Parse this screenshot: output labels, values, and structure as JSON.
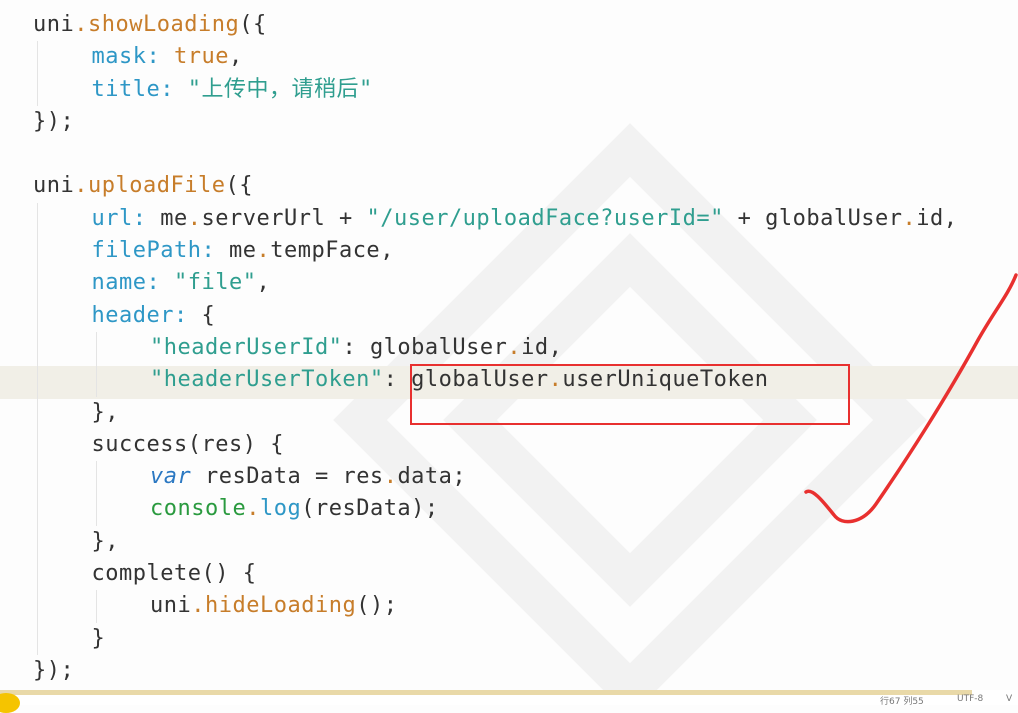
{
  "editor": {
    "highlight_color": "#f1efe7",
    "lines": [
      {
        "indent": 0,
        "tokens": [
          {
            "text": "uni",
            "cls": "p"
          },
          {
            "text": ".",
            "cls": "f"
          },
          {
            "text": "showLoading",
            "cls": "f"
          },
          {
            "text": "({",
            "cls": "p"
          }
        ]
      },
      {
        "indent": 1,
        "tokens": [
          {
            "text": "mask",
            "cls": "k"
          },
          {
            "text": ": ",
            "cls": "k"
          },
          {
            "text": "true",
            "cls": "b"
          },
          {
            "text": ",",
            "cls": "p"
          }
        ]
      },
      {
        "indent": 1,
        "tokens": [
          {
            "text": "title",
            "cls": "k"
          },
          {
            "text": ": ",
            "cls": "k"
          },
          {
            "text": "\"上传中，请稍后\"",
            "cls": "s"
          }
        ]
      },
      {
        "indent": 0,
        "tokens": [
          {
            "text": "});",
            "cls": "p"
          }
        ]
      },
      {
        "indent": 0,
        "tokens": []
      },
      {
        "indent": 0,
        "tokens": [
          {
            "text": "uni",
            "cls": "p"
          },
          {
            "text": ".",
            "cls": "f"
          },
          {
            "text": "uploadFile",
            "cls": "f"
          },
          {
            "text": "({",
            "cls": "p"
          }
        ]
      },
      {
        "indent": 1,
        "tokens": [
          {
            "text": "url",
            "cls": "k"
          },
          {
            "text": ": ",
            "cls": "k"
          },
          {
            "text": "me",
            "cls": "p"
          },
          {
            "text": ".",
            "cls": "f"
          },
          {
            "text": "serverUrl",
            "cls": "p"
          },
          {
            "text": " + ",
            "cls": "p"
          },
          {
            "text": "\"/user/uploadFace?userId=\"",
            "cls": "s"
          },
          {
            "text": " + ",
            "cls": "p"
          },
          {
            "text": "globalUser",
            "cls": "p"
          },
          {
            "text": ".",
            "cls": "f"
          },
          {
            "text": "id",
            "cls": "p"
          },
          {
            "text": ",",
            "cls": "p"
          }
        ]
      },
      {
        "indent": 1,
        "tokens": [
          {
            "text": "filePath",
            "cls": "k"
          },
          {
            "text": ": ",
            "cls": "k"
          },
          {
            "text": "me",
            "cls": "p"
          },
          {
            "text": ".",
            "cls": "f"
          },
          {
            "text": "tempFace",
            "cls": "p"
          },
          {
            "text": ",",
            "cls": "p"
          }
        ]
      },
      {
        "indent": 1,
        "tokens": [
          {
            "text": "name",
            "cls": "k"
          },
          {
            "text": ": ",
            "cls": "k"
          },
          {
            "text": "\"file\"",
            "cls": "s"
          },
          {
            "text": ",",
            "cls": "p"
          }
        ]
      },
      {
        "indent": 1,
        "tokens": [
          {
            "text": "header",
            "cls": "k"
          },
          {
            "text": ": ",
            "cls": "k"
          },
          {
            "text": "{",
            "cls": "p"
          }
        ]
      },
      {
        "indent": 2,
        "tokens": [
          {
            "text": "\"headerUserId\"",
            "cls": "s"
          },
          {
            "text": ": ",
            "cls": "p"
          },
          {
            "text": "globalUser",
            "cls": "p"
          },
          {
            "text": ".",
            "cls": "f"
          },
          {
            "text": "id",
            "cls": "p"
          },
          {
            "text": ",",
            "cls": "p"
          }
        ]
      },
      {
        "indent": 2,
        "highlight": true,
        "tokens": [
          {
            "text": "\"headerUserToken\"",
            "cls": "s"
          },
          {
            "text": ": ",
            "cls": "p"
          },
          {
            "text": "globalUser",
            "cls": "p"
          },
          {
            "text": ".",
            "cls": "f"
          },
          {
            "text": "userUniqueToken",
            "cls": "p"
          }
        ]
      },
      {
        "indent": 1,
        "tokens": [
          {
            "text": "},",
            "cls": "p"
          }
        ]
      },
      {
        "indent": 1,
        "tokens": [
          {
            "text": "success",
            "cls": "p"
          },
          {
            "text": "(res) {",
            "cls": "p"
          }
        ]
      },
      {
        "indent": 2,
        "tokens": [
          {
            "text": "var",
            "cls": "v"
          },
          {
            "text": " resData = res",
            "cls": "p"
          },
          {
            "text": ".",
            "cls": "f"
          },
          {
            "text": "data",
            "cls": "p"
          },
          {
            "text": ";",
            "cls": "p"
          }
        ]
      },
      {
        "indent": 2,
        "tokens": [
          {
            "text": "console",
            "cls": "c"
          },
          {
            "text": ".",
            "cls": "f"
          },
          {
            "text": "log",
            "cls": "k"
          },
          {
            "text": "(resData);",
            "cls": "p"
          }
        ]
      },
      {
        "indent": 1,
        "tokens": [
          {
            "text": "},",
            "cls": "p"
          }
        ]
      },
      {
        "indent": 1,
        "tokens": [
          {
            "text": "complete",
            "cls": "p"
          },
          {
            "text": "() {",
            "cls": "p"
          }
        ]
      },
      {
        "indent": 2,
        "tokens": [
          {
            "text": "uni",
            "cls": "p"
          },
          {
            "text": ".",
            "cls": "f"
          },
          {
            "text": "hideLoading",
            "cls": "f"
          },
          {
            "text": "();",
            "cls": "p"
          }
        ]
      },
      {
        "indent": 1,
        "tokens": [
          {
            "text": "}",
            "cls": "p"
          }
        ]
      },
      {
        "indent": 0,
        "tokens": [
          {
            "text": "});",
            "cls": "p"
          }
        ]
      }
    ]
  },
  "annotation": {
    "color": "#e8302f"
  },
  "status_bar": {
    "items": [
      "行67  列55",
      "UTF-8",
      "V"
    ]
  }
}
